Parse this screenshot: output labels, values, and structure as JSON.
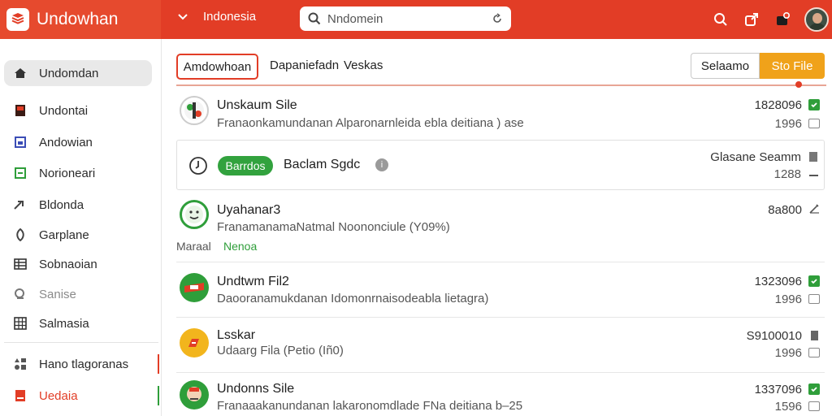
{
  "app": {
    "title": "Undowhan"
  },
  "topbar": {
    "region": "Indonesia",
    "search_placeholder": "Nndomein",
    "accent": "#e23d26"
  },
  "sidebar": {
    "items": [
      {
        "label": "Undomdan",
        "icon": "home-icon"
      },
      {
        "label": "Undontai",
        "icon": "square-icon"
      },
      {
        "label": "Andowian",
        "icon": "square-icon"
      },
      {
        "label": "Norioneari",
        "icon": "square-icon"
      },
      {
        "label": "Bldonda",
        "icon": "arrow-icon"
      },
      {
        "label": "Garplane",
        "icon": "leaf-icon"
      },
      {
        "label": "Sobnaoian",
        "icon": "grid-icon"
      },
      {
        "label": "Sanise",
        "icon": "search-icon"
      },
      {
        "label": "Salmasia",
        "icon": "grid-icon"
      },
      {
        "label": "Hano tlagoranas",
        "icon": "shapes-icon"
      },
      {
        "label": "Uedaia",
        "icon": "doc-icon"
      }
    ]
  },
  "tabs": {
    "items": [
      "Amdowhoan",
      "Dapaniefadn",
      "Veskas"
    ]
  },
  "actions": {
    "secondary": "Selaamo",
    "primary": "Sto File",
    "primary_color": "#f0a21a"
  },
  "rows": [
    {
      "title": "Unskaum Sile",
      "subtitle": "Franaonkamundanan Alparonarnleida ebla deitiana ) ase",
      "value": "1828096",
      "sub_value": "1996"
    },
    {
      "title": "Uyahanar3",
      "subtitle": "FranamanamaNatmal Noononciule (Y09%)",
      "value": "8a800",
      "sub_value": ""
    },
    {
      "title": "Undtwm Fil2",
      "subtitle": "Daooranamukdanan Idomonrnaisodeabla lietagra)",
      "value": "1323096",
      "sub_value": "1996"
    },
    {
      "title": "Lsskar",
      "subtitle": "Udaarg Fila (Petio (Iñ0)",
      "value": "S9100010",
      "sub_value": "1996"
    },
    {
      "title": "Undonns Sile",
      "subtitle": "Franaaakanundanan lakaronomdlade FNa deitiana b–25",
      "value": "1337096",
      "sub_value": "1596"
    }
  ],
  "card": {
    "badge": "Barrdos",
    "title": "Baclam Sgdc",
    "value": "Glasane Seamm",
    "sub_value": "1288"
  },
  "green_note": {
    "label": "Maraal",
    "value": "Nenoa"
  }
}
